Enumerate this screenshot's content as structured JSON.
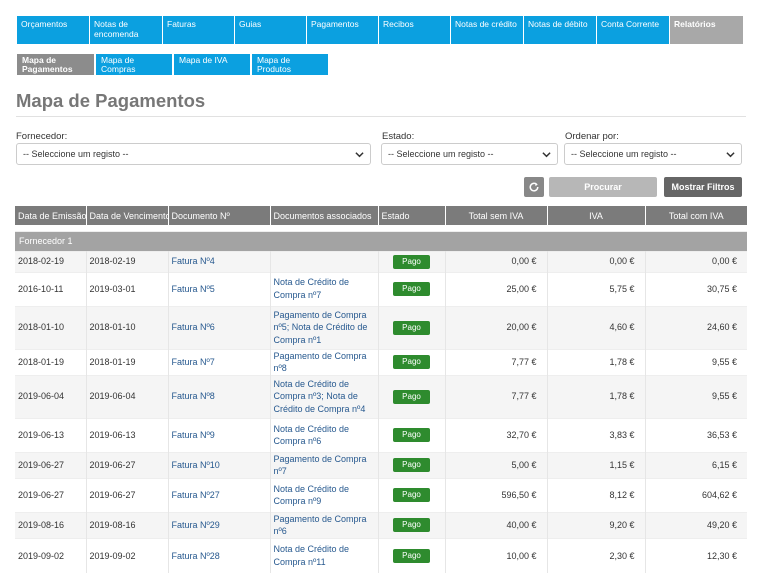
{
  "nav": {
    "tabs": [
      {
        "label": "Orçamentos",
        "active": false
      },
      {
        "label": "Notas de encomenda",
        "active": false
      },
      {
        "label": "Faturas",
        "active": false
      },
      {
        "label": "Guias",
        "active": false
      },
      {
        "label": "Pagamentos",
        "active": false
      },
      {
        "label": "Recibos",
        "active": false
      },
      {
        "label": "Notas de crédito",
        "active": false
      },
      {
        "label": "Notas de débito",
        "active": false
      },
      {
        "label": "Conta Corrente",
        "active": false
      },
      {
        "label": "Relatórios",
        "active": true
      }
    ],
    "subtabs": [
      {
        "label": "Mapa de Pagamentos",
        "active": true
      },
      {
        "label": "Mapa de Compras",
        "active": false
      },
      {
        "label": "Mapa de IVA",
        "active": false
      },
      {
        "label": "Mapa de Produtos Comprados",
        "active": false
      }
    ]
  },
  "page": {
    "title": "Mapa de Pagamentos"
  },
  "filters": {
    "supplier_label": "Fornecedor:",
    "supplier_value": "-- Seleccione um registo --",
    "status_label": "Estado:",
    "status_value": "-- Seleccione um registo --",
    "order_label": "Ordenar por:",
    "order_value": "-- Seleccione um registo --"
  },
  "actions": {
    "refresh_icon": "refresh-icon",
    "search_label": "Procurar",
    "filters_label": "Mostrar Filtros"
  },
  "colors": {
    "nav_blue": "#0ba0e0",
    "active_tab": "#a8a8a8",
    "header_gray": "#7b7b7b",
    "group_gray": "#a3a3a3",
    "status_green": "#2e8b2e",
    "link_blue": "#27598f"
  },
  "table": {
    "columns": [
      "Data de Emissão",
      "Data de Vencimento",
      "Documento Nº",
      "Documentos associados",
      "Estado",
      "Total sem IVA",
      "IVA",
      "Total com IVA"
    ],
    "group_label": "Fornecedor 1",
    "rows": [
      {
        "issue_date": "2018-02-19",
        "due_date": "2018-02-19",
        "document": "Fatura Nº4",
        "associated": [],
        "status": "Pago",
        "total_no_vat": "0,00 €",
        "vat": "0,00 €",
        "total_with_vat": "0,00 €"
      },
      {
        "issue_date": "2016-10-11",
        "due_date": "2019-03-01",
        "document": "Fatura Nº5",
        "associated": [
          "Nota de Crédito de",
          "Compra nº7"
        ],
        "status": "Pago",
        "total_no_vat": "25,00 €",
        "vat": "5,75 €",
        "total_with_vat": "30,75 €"
      },
      {
        "issue_date": "2018-01-10",
        "due_date": "2018-01-10",
        "document": "Fatura Nº6",
        "associated": [
          "Pagamento de Compra",
          "nº5; Nota de Crédito de",
          "Compra nº1"
        ],
        "status": "Pago",
        "total_no_vat": "20,00 €",
        "vat": "4,60 €",
        "total_with_vat": "24,60 €"
      },
      {
        "issue_date": "2018-01-19",
        "due_date": "2018-01-19",
        "document": "Fatura Nº7",
        "associated": [
          "Pagamento de Compra nº8"
        ],
        "status": "Pago",
        "total_no_vat": "7,77 €",
        "vat": "1,78 €",
        "total_with_vat": "9,55 €"
      },
      {
        "issue_date": "2019-06-04",
        "due_date": "2019-06-04",
        "document": "Fatura Nº8",
        "associated": [
          "Nota de Crédito de",
          "Compra nº3; Nota de",
          "Crédito de Compra nº4"
        ],
        "status": "Pago",
        "total_no_vat": "7,77 €",
        "vat": "1,78 €",
        "total_with_vat": "9,55 €"
      },
      {
        "issue_date": "2019-06-13",
        "due_date": "2019-06-13",
        "document": "Fatura Nº9",
        "associated": [
          "Nota de Crédito de",
          "Compra nº6"
        ],
        "status": "Pago",
        "total_no_vat": "32,70 €",
        "vat": "3,83 €",
        "total_with_vat": "36,53 €"
      },
      {
        "issue_date": "2019-06-27",
        "due_date": "2019-06-27",
        "document": "Fatura Nº10",
        "associated": [
          "Pagamento de Compra nº7"
        ],
        "status": "Pago",
        "total_no_vat": "5,00 €",
        "vat": "1,15 €",
        "total_with_vat": "6,15 €"
      },
      {
        "issue_date": "2019-06-27",
        "due_date": "2019-06-27",
        "document": "Fatura Nº27",
        "associated": [
          "Nota de Crédito de",
          "Compra nº9"
        ],
        "status": "Pago",
        "total_no_vat": "596,50 €",
        "vat": "8,12 €",
        "total_with_vat": "604,62 €"
      },
      {
        "issue_date": "2019-08-16",
        "due_date": "2019-08-16",
        "document": "Fatura Nº29",
        "associated": [
          "Pagamento de Compra nº6"
        ],
        "status": "Pago",
        "total_no_vat": "40,00 €",
        "vat": "9,20 €",
        "total_with_vat": "49,20 €"
      },
      {
        "issue_date": "2019-09-02",
        "due_date": "2019-09-02",
        "document": "Fatura Nº28",
        "associated": [
          "Nota de Crédito de",
          "Compra nº11"
        ],
        "status": "Pago",
        "total_no_vat": "10,00 €",
        "vat": "2,30 €",
        "total_with_vat": "12,30 €"
      }
    ]
  }
}
